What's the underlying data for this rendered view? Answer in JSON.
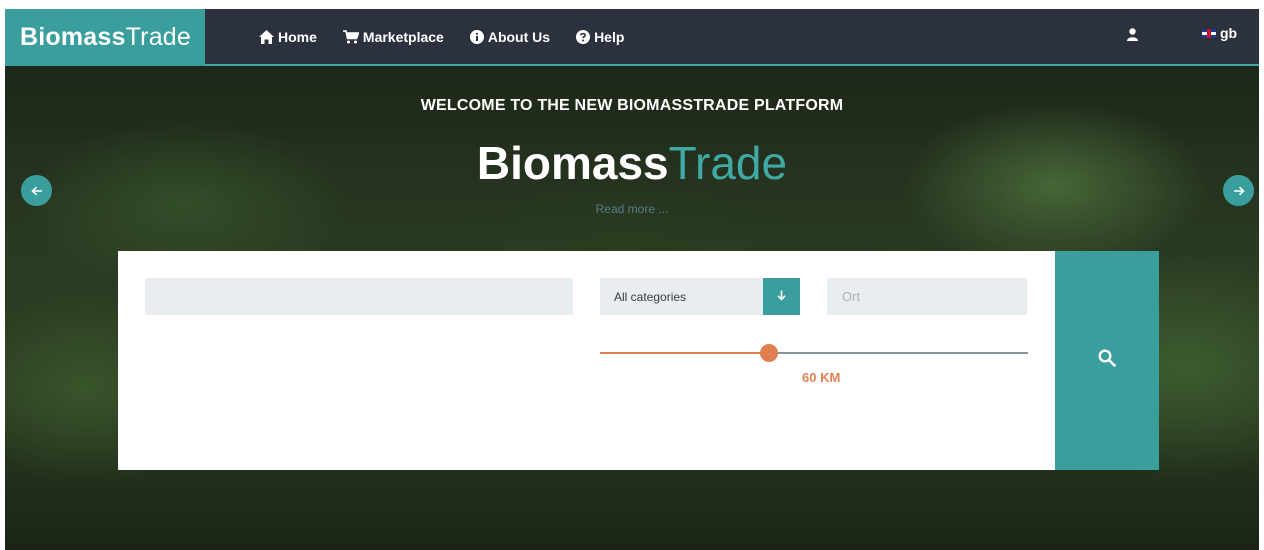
{
  "brand": {
    "bold": "Biomass",
    "light": "Trade"
  },
  "nav": {
    "items": [
      {
        "label": "Home",
        "icon": "home-icon"
      },
      {
        "label": "Marketplace",
        "icon": "cart-icon"
      },
      {
        "label": "About Us",
        "icon": "info-icon"
      },
      {
        "label": "Help",
        "icon": "question-icon"
      }
    ],
    "user_icon": "user-icon",
    "language": "gb"
  },
  "hero": {
    "title": "WELCOME TO THE NEW BIOMASSTRADE PLATFORM",
    "logo_bold": "Biomass",
    "logo_accent": "Trade",
    "read_more": "Read more ...",
    "prev_icon": "arrow-left-icon",
    "next_icon": "arrow-right-icon"
  },
  "search": {
    "keyword_value": "",
    "category_selected": "All categories",
    "category_icon": "arrow-down-icon",
    "location_placeholder": "Ort",
    "distance_fraction": 0.395,
    "distance_label": "60 KM",
    "search_icon": "search-icon"
  },
  "colors": {
    "accent": "#3a9e9c",
    "nav_bg": "#2c323d",
    "slider": "#e07f52"
  }
}
